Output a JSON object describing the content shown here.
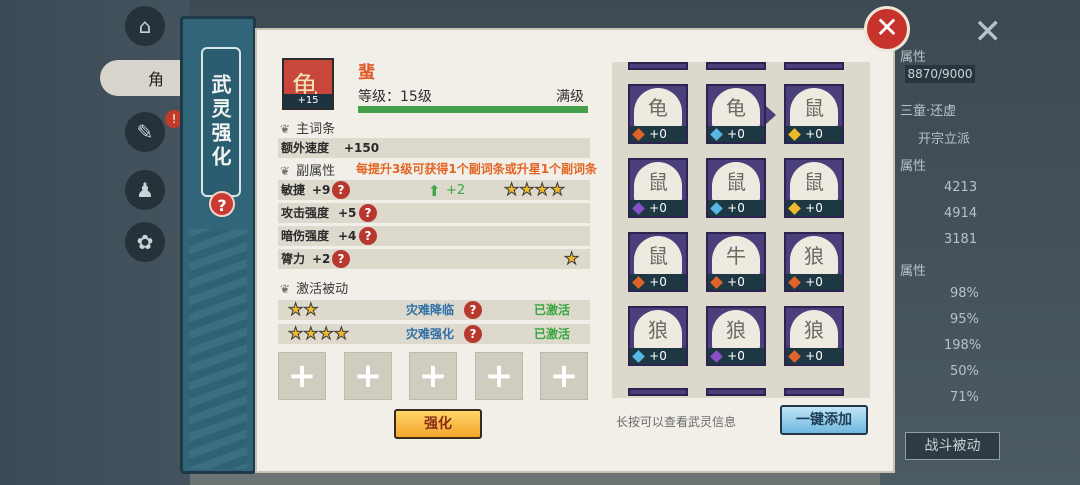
{
  "background": {
    "tab_label": "角",
    "alert_badge": "!",
    "close_glyph": "✕",
    "stats": [
      {
        "label": "属性",
        "value": ""
      },
      {
        "label": "",
        "value": "8870/9000"
      },
      {
        "label": "三童·还虚",
        "value": ""
      },
      {
        "label": "开宗立派",
        "value": ""
      },
      {
        "label": "属性",
        "value": ""
      },
      {
        "label": "",
        "value": "4213"
      },
      {
        "label": "",
        "value": "4914"
      },
      {
        "label": "",
        "value": "3181"
      },
      {
        "label": "属性",
        "value": ""
      },
      {
        "label": "",
        "value": "98%"
      },
      {
        "label": "",
        "value": "95%"
      },
      {
        "label": "",
        "value": "198%"
      },
      {
        "label": "",
        "value": "50%"
      },
      {
        "label": "",
        "value": "71%"
      }
    ],
    "battle_passive_button": "战斗被动"
  },
  "banner": {
    "title": "武灵强化",
    "help": "?"
  },
  "close_button": "✕",
  "spirit": {
    "name": "蜚",
    "level_text": "等级：15级",
    "max_text": "满级",
    "level_progress": 1.0,
    "avatar_badge": "+15",
    "avatar_glyph": "龟"
  },
  "main_affix": {
    "section": "主词条",
    "label": "额外速度",
    "value": "+150"
  },
  "sub_affix": {
    "section": "副属性",
    "hint": "每提升3级可获得1个副词条或升星1个副词条",
    "rows": [
      {
        "label": "敏捷",
        "value": "+9",
        "upgrade": "+2",
        "stars": 4
      },
      {
        "label": "攻击强度",
        "value": "+5",
        "stars": 0
      },
      {
        "label": "暗伤强度",
        "value": "+4",
        "stars": 0
      },
      {
        "label": "膂力",
        "value": "+2",
        "stars": 1
      }
    ]
  },
  "passive": {
    "section": "激活被动",
    "rows": [
      {
        "stars": 2,
        "name": "灾难降临",
        "status": "已激活"
      },
      {
        "stars": 4,
        "name": "灾难强化",
        "status": "已激活"
      }
    ]
  },
  "slots": [
    "+",
    "+",
    "+",
    "+",
    "+"
  ],
  "strengthen_button": "强化",
  "grid": {
    "cards": [
      {
        "glyph": "龟",
        "count": "+0",
        "gem": "#e0642a"
      },
      {
        "glyph": "龟",
        "count": "+0",
        "gem": "#58b6e6"
      },
      {
        "glyph": "鼠",
        "count": "+0",
        "gem": "#f0b92c"
      },
      {
        "glyph": "鼠",
        "count": "+0",
        "gem": "#8a4fc7"
      },
      {
        "glyph": "鼠",
        "count": "+0",
        "gem": "#58b6e6"
      },
      {
        "glyph": "鼠",
        "count": "+0",
        "gem": "#f0b92c"
      },
      {
        "glyph": "鼠",
        "count": "+0",
        "gem": "#e0642a"
      },
      {
        "glyph": "牛",
        "count": "+0",
        "gem": "#e0642a"
      },
      {
        "glyph": "狼",
        "count": "+0",
        "gem": "#e0642a"
      },
      {
        "glyph": "狼",
        "count": "+0",
        "gem": "#58b6e6"
      },
      {
        "glyph": "狼",
        "count": "+0",
        "gem": "#8a4fc7"
      },
      {
        "glyph": "狼",
        "count": "+0",
        "gem": "#e0642a"
      }
    ]
  },
  "press_hint": "长按可以查看武灵信息",
  "add_all_button": "一键添加"
}
